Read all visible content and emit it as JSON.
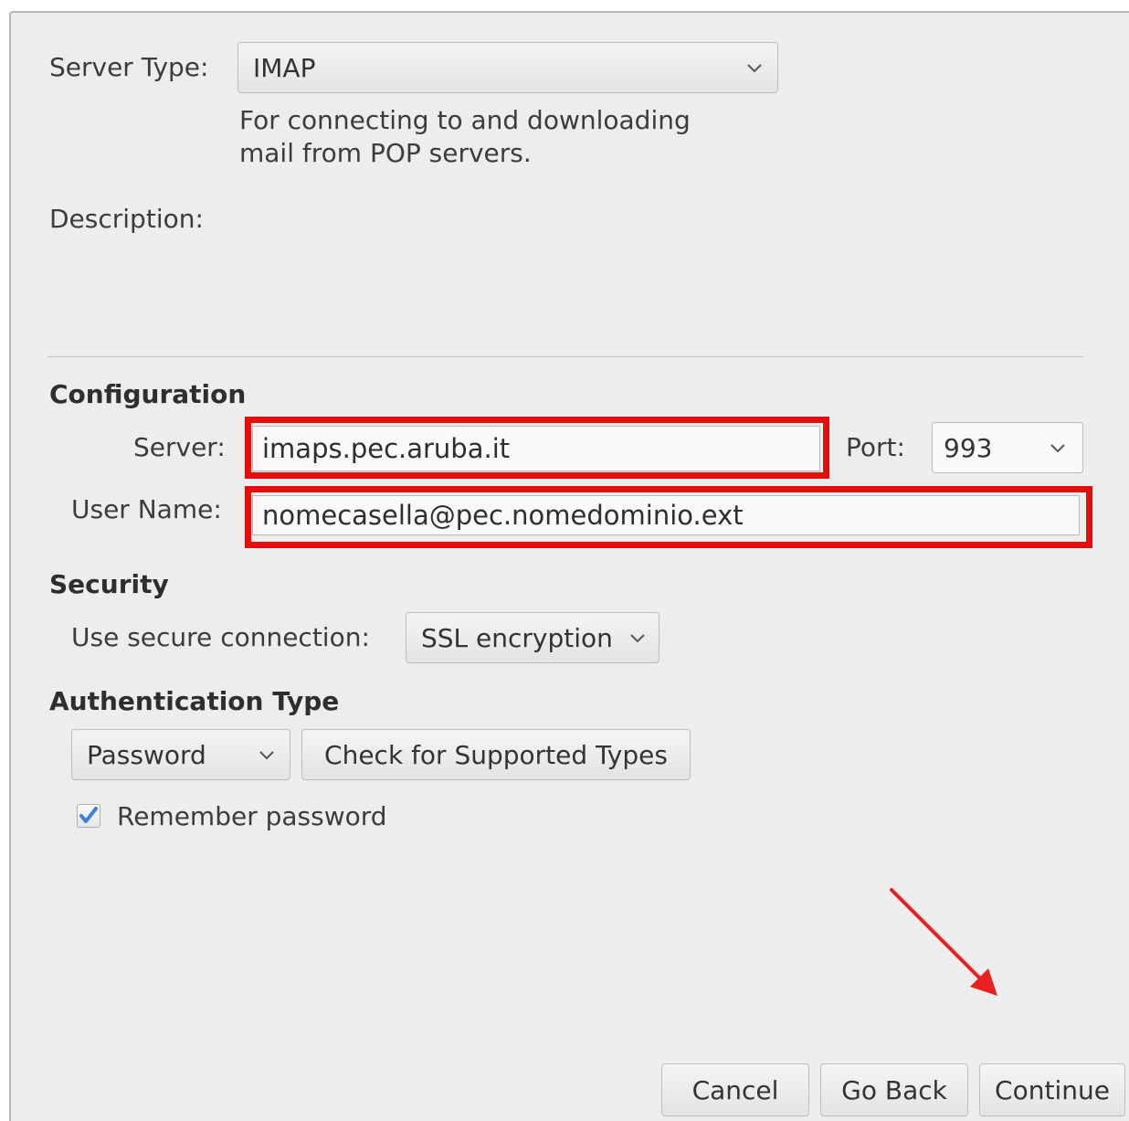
{
  "server_type": {
    "label": "Server Type:",
    "value": "IMAP",
    "help_line1": "For connecting to and downloading",
    "help_line2": "mail from POP servers."
  },
  "description": {
    "label": "Description:"
  },
  "configuration": {
    "heading": "Configuration",
    "server_label": "Server:",
    "server_value": "imaps.pec.aruba.it",
    "port_label": "Port:",
    "port_value": "993",
    "username_label": "User Name:",
    "username_value": "nomecasella@pec.nomedominio.ext"
  },
  "security": {
    "heading": "Security",
    "secure_label": "Use secure connection:",
    "secure_value": "SSL encryption"
  },
  "authentication": {
    "heading": "Authentication Type",
    "type_value": "Password",
    "check_button": "Check for Supported Types",
    "remember_label": "Remember password",
    "remember_checked": true
  },
  "footer": {
    "cancel": "Cancel",
    "go_back": "Go Back",
    "continue": "Continue"
  },
  "colors": {
    "highlight": "#e80d0d",
    "dialog_bg": "#ededed",
    "check_blue": "#3d7fd8"
  },
  "icons": {
    "dropdown": "chevron-down-icon",
    "check": "checkmark-icon",
    "annotation": "arrow-annotation-icon"
  }
}
